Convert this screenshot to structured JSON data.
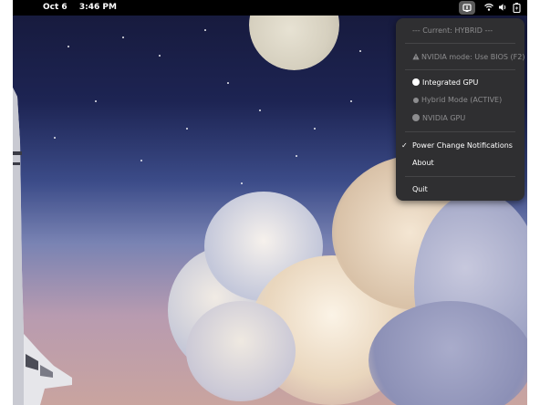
{
  "topbar": {
    "date": "Oct 6",
    "time": "3:46 PM",
    "icons": {
      "gpu_switcher": "gpu-switcher-icon",
      "wifi": "wifi-icon",
      "volume": "volume-icon",
      "battery": "battery-icon"
    }
  },
  "menu": {
    "current_status": "--- Current: HYBRID ---",
    "nvidia_mode_warning": "NVIDIA mode: Use BIOS (F2)",
    "integrated_gpu": "Integrated GPU",
    "hybrid_mode": "Hybrid Mode (ACTIVE)",
    "nvidia_gpu": "NVIDIA GPU",
    "power_change_notifications": "Power Change Notifications",
    "about": "About",
    "quit": "Quit"
  },
  "colors": {
    "menu_bg": "#2f2f31",
    "topbar_bg": "#000000",
    "dimmed_text": "#8d8d8f",
    "tray_active_bg": "#5b5b5b"
  }
}
